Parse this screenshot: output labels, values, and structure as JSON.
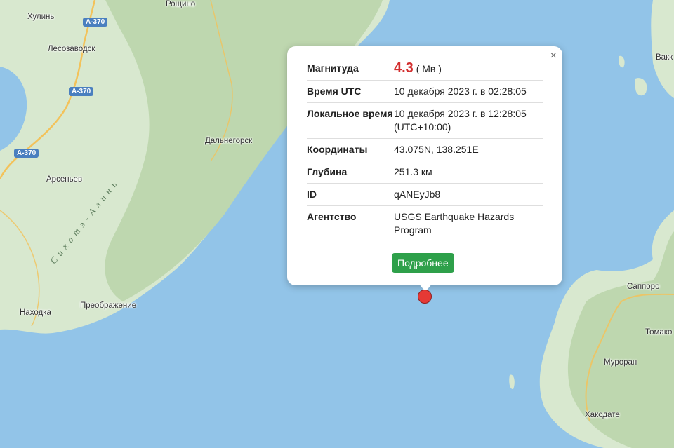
{
  "map": {
    "colors": {
      "sea": "#92c4e8",
      "land": "#d8e8cf",
      "forest": "#bed7af",
      "road": "#f3c25a",
      "coast": "#c7dcc0"
    },
    "places": {
      "khulin": "Хулинь",
      "roshchino": "Рощино",
      "lesozavodsk": "Лесозаводск",
      "dalnegorsk": "Дальнегорск",
      "arsenyev": "Арсеньев",
      "nakhodka": "Находка",
      "preobrazhenie": "Преображение",
      "sapporo": "Саппоро",
      "tomakomai": "Томако",
      "muroran": "Муроран",
      "hakodate": "Хакодате",
      "vakk": "Вакк"
    },
    "roads": {
      "a370": "А-370"
    },
    "range_label": "Сихотэ-Алинь",
    "marker_icon": "earthquake-epicenter-icon"
  },
  "popup": {
    "close_icon": "×",
    "magnitude_label": "Магнитуда",
    "magnitude_value": "4.3",
    "magnitude_unit": "( Mв )",
    "utc_label": "Время UTC",
    "utc_value": "10 декабря 2023 г. в 02:28:05",
    "local_label": "Локальное время",
    "local_value": "10 декабря 2023 г. в 12:28:05 (UTC+10:00)",
    "coords_label": "Координаты",
    "coords_value": "43.075N, 138.251E",
    "depth_label": "Глубина",
    "depth_value": "251.3 км",
    "id_label": "ID",
    "id_value": "qANEyJb8",
    "agency_label": "Агентство",
    "agency_value": "USGS Earthquake Hazards Program",
    "more_button": "Подробнее"
  }
}
